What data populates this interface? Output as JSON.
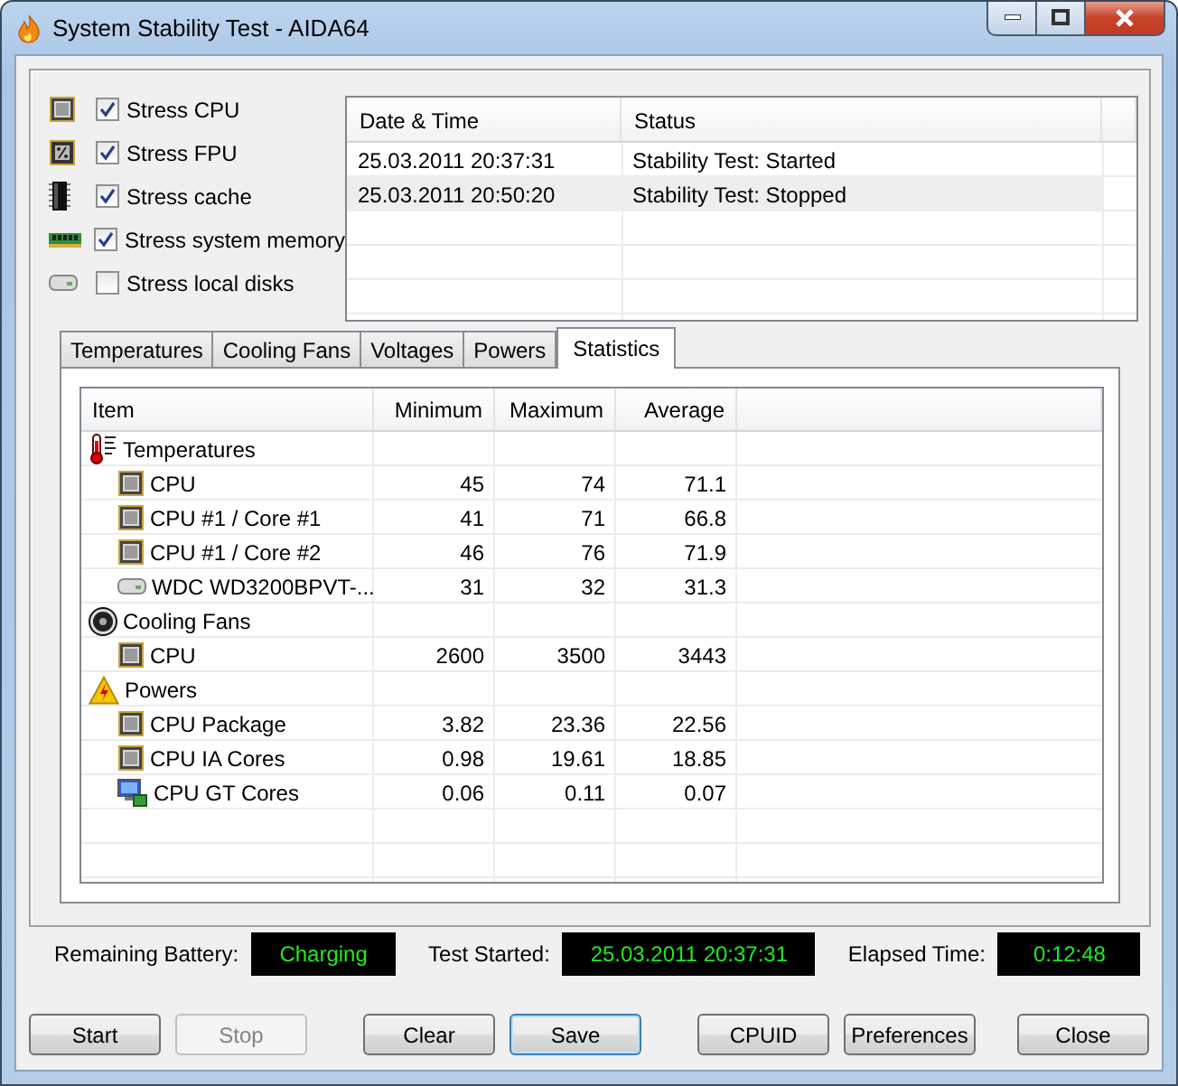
{
  "window": {
    "title": "System Stability Test - AIDA64"
  },
  "stress_options": [
    {
      "kind": "cpu",
      "label": "Stress CPU",
      "checked": true
    },
    {
      "kind": "fpu",
      "label": "Stress FPU",
      "checked": true
    },
    {
      "kind": "cache",
      "label": "Stress cache",
      "checked": true
    },
    {
      "kind": "memory",
      "label": "Stress system memory",
      "checked": true
    },
    {
      "kind": "disk",
      "label": "Stress local disks",
      "checked": false
    }
  ],
  "log": {
    "columns": [
      "Date & Time",
      "Status"
    ],
    "rows": [
      {
        "date_time": "25.03.2011 20:37:31",
        "status": "Stability Test: Started",
        "selected": false
      },
      {
        "date_time": "25.03.2011 20:50:20",
        "status": "Stability Test: Stopped",
        "selected": true
      }
    ]
  },
  "tabs": [
    {
      "label": "Temperatures",
      "selected": false
    },
    {
      "label": "Cooling Fans",
      "selected": false
    },
    {
      "label": "Voltages",
      "selected": false
    },
    {
      "label": "Powers",
      "selected": false
    },
    {
      "label": "Statistics",
      "selected": true
    }
  ],
  "statistics": {
    "columns": [
      "Item",
      "Minimum",
      "Maximum",
      "Average"
    ],
    "groups": [
      {
        "kind": "temperature",
        "label": "Temperatures",
        "children": [
          {
            "kind": "cpu",
            "item": "CPU",
            "minimum": "45",
            "maximum": "74",
            "average": "71.1"
          },
          {
            "kind": "cpu",
            "item": "CPU #1 / Core #1",
            "minimum": "41",
            "maximum": "71",
            "average": "66.8"
          },
          {
            "kind": "cpu",
            "item": "CPU #1 / Core #2",
            "minimum": "46",
            "maximum": "76",
            "average": "71.9"
          },
          {
            "kind": "disk",
            "item": "WDC WD3200BPVT-...",
            "minimum": "31",
            "maximum": "32",
            "average": "31.3"
          }
        ]
      },
      {
        "kind": "fan",
        "label": "Cooling Fans",
        "children": [
          {
            "kind": "cpu",
            "item": "CPU",
            "minimum": "2600",
            "maximum": "3500",
            "average": "3443"
          }
        ]
      },
      {
        "kind": "power",
        "label": "Powers",
        "children": [
          {
            "kind": "cpu",
            "item": "CPU Package",
            "minimum": "3.82",
            "maximum": "23.36",
            "average": "22.56"
          },
          {
            "kind": "cpu",
            "item": "CPU IA Cores",
            "minimum": "0.98",
            "maximum": "19.61",
            "average": "18.85"
          },
          {
            "kind": "gpu",
            "item": "CPU GT Cores",
            "minimum": "0.06",
            "maximum": "0.11",
            "average": "0.07"
          }
        ]
      }
    ]
  },
  "status": [
    {
      "label": "Remaining Battery:",
      "value": "Charging"
    },
    {
      "label": "Test Started:",
      "value": "25.03.2011 20:37:31"
    },
    {
      "label": "Elapsed Time:",
      "value": "0:12:48"
    }
  ],
  "buttons": [
    {
      "label": "Start",
      "disabled": false,
      "default": false
    },
    {
      "label": "Stop",
      "disabled": true,
      "default": false
    },
    {
      "label": "Clear",
      "disabled": false,
      "default": false
    },
    {
      "label": "Save",
      "disabled": false,
      "default": true
    },
    {
      "label": "CPUID",
      "disabled": false,
      "default": false
    },
    {
      "label": "Preferences",
      "disabled": false,
      "default": false
    },
    {
      "label": "Close",
      "disabled": false,
      "default": false
    }
  ]
}
